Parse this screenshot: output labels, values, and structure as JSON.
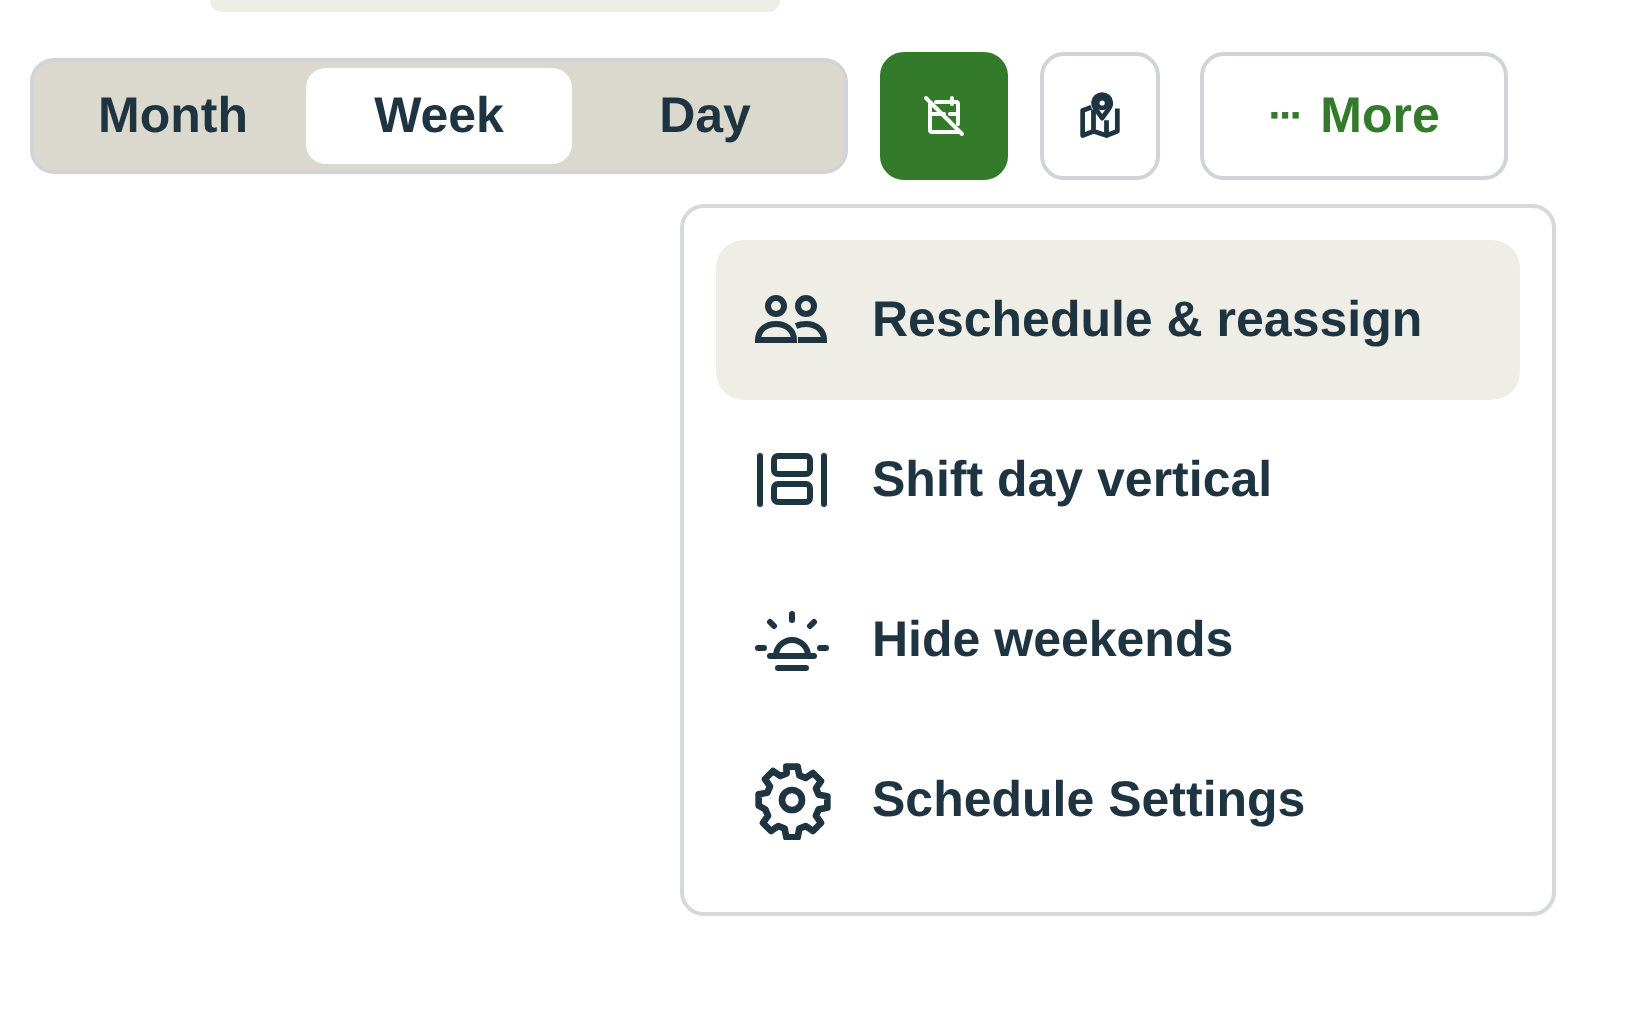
{
  "view_switcher": [
    {
      "label": "Month",
      "selected": false
    },
    {
      "label": "Week",
      "selected": true
    },
    {
      "label": "Day",
      "selected": false
    }
  ],
  "tool_buttons": [
    {
      "kind": "calendar-off",
      "active": true
    },
    {
      "kind": "map",
      "active": false
    }
  ],
  "more_button": {
    "icon": "···",
    "label": "More"
  },
  "menu": [
    {
      "kind": "people",
      "label": "Reschedule & reassign",
      "selected": true
    },
    {
      "kind": "columns",
      "label": "Shift day vertical",
      "selected": false
    },
    {
      "kind": "sunrise",
      "label": "Hide weekends",
      "selected": false
    },
    {
      "kind": "gear",
      "label": "Schedule Settings",
      "selected": false
    }
  ]
}
